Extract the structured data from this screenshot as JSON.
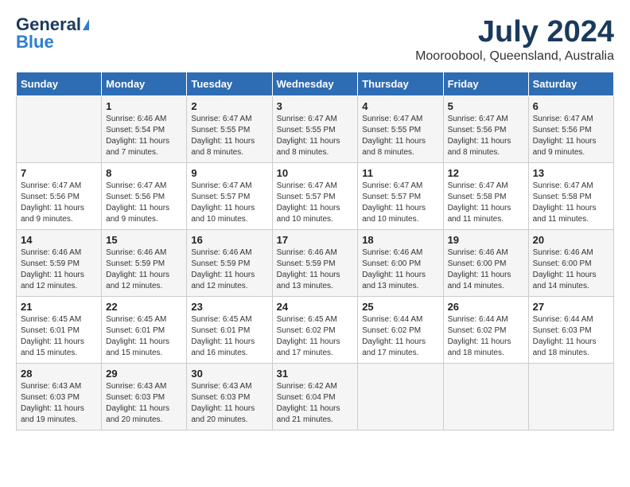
{
  "header": {
    "logo_general": "General",
    "logo_blue": "Blue",
    "month_title": "July 2024",
    "location": "Mooroobool, Queensland, Australia"
  },
  "weekdays": [
    "Sunday",
    "Monday",
    "Tuesday",
    "Wednesday",
    "Thursday",
    "Friday",
    "Saturday"
  ],
  "weeks": [
    [
      {
        "day": "",
        "sunrise": "",
        "sunset": "",
        "daylight": ""
      },
      {
        "day": "1",
        "sunrise": "6:46 AM",
        "sunset": "5:54 PM",
        "daylight": "11 hours and 7 minutes."
      },
      {
        "day": "2",
        "sunrise": "6:47 AM",
        "sunset": "5:55 PM",
        "daylight": "11 hours and 8 minutes."
      },
      {
        "day": "3",
        "sunrise": "6:47 AM",
        "sunset": "5:55 PM",
        "daylight": "11 hours and 8 minutes."
      },
      {
        "day": "4",
        "sunrise": "6:47 AM",
        "sunset": "5:55 PM",
        "daylight": "11 hours and 8 minutes."
      },
      {
        "day": "5",
        "sunrise": "6:47 AM",
        "sunset": "5:56 PM",
        "daylight": "11 hours and 8 minutes."
      },
      {
        "day": "6",
        "sunrise": "6:47 AM",
        "sunset": "5:56 PM",
        "daylight": "11 hours and 9 minutes."
      }
    ],
    [
      {
        "day": "7",
        "sunrise": "6:47 AM",
        "sunset": "5:56 PM",
        "daylight": "11 hours and 9 minutes."
      },
      {
        "day": "8",
        "sunrise": "6:47 AM",
        "sunset": "5:56 PM",
        "daylight": "11 hours and 9 minutes."
      },
      {
        "day": "9",
        "sunrise": "6:47 AM",
        "sunset": "5:57 PM",
        "daylight": "11 hours and 10 minutes."
      },
      {
        "day": "10",
        "sunrise": "6:47 AM",
        "sunset": "5:57 PM",
        "daylight": "11 hours and 10 minutes."
      },
      {
        "day": "11",
        "sunrise": "6:47 AM",
        "sunset": "5:57 PM",
        "daylight": "11 hours and 10 minutes."
      },
      {
        "day": "12",
        "sunrise": "6:47 AM",
        "sunset": "5:58 PM",
        "daylight": "11 hours and 11 minutes."
      },
      {
        "day": "13",
        "sunrise": "6:47 AM",
        "sunset": "5:58 PM",
        "daylight": "11 hours and 11 minutes."
      }
    ],
    [
      {
        "day": "14",
        "sunrise": "6:46 AM",
        "sunset": "5:59 PM",
        "daylight": "11 hours and 12 minutes."
      },
      {
        "day": "15",
        "sunrise": "6:46 AM",
        "sunset": "5:59 PM",
        "daylight": "11 hours and 12 minutes."
      },
      {
        "day": "16",
        "sunrise": "6:46 AM",
        "sunset": "5:59 PM",
        "daylight": "11 hours and 12 minutes."
      },
      {
        "day": "17",
        "sunrise": "6:46 AM",
        "sunset": "5:59 PM",
        "daylight": "11 hours and 13 minutes."
      },
      {
        "day": "18",
        "sunrise": "6:46 AM",
        "sunset": "6:00 PM",
        "daylight": "11 hours and 13 minutes."
      },
      {
        "day": "19",
        "sunrise": "6:46 AM",
        "sunset": "6:00 PM",
        "daylight": "11 hours and 14 minutes."
      },
      {
        "day": "20",
        "sunrise": "6:46 AM",
        "sunset": "6:00 PM",
        "daylight": "11 hours and 14 minutes."
      }
    ],
    [
      {
        "day": "21",
        "sunrise": "6:45 AM",
        "sunset": "6:01 PM",
        "daylight": "11 hours and 15 minutes."
      },
      {
        "day": "22",
        "sunrise": "6:45 AM",
        "sunset": "6:01 PM",
        "daylight": "11 hours and 15 minutes."
      },
      {
        "day": "23",
        "sunrise": "6:45 AM",
        "sunset": "6:01 PM",
        "daylight": "11 hours and 16 minutes."
      },
      {
        "day": "24",
        "sunrise": "6:45 AM",
        "sunset": "6:02 PM",
        "daylight": "11 hours and 17 minutes."
      },
      {
        "day": "25",
        "sunrise": "6:44 AM",
        "sunset": "6:02 PM",
        "daylight": "11 hours and 17 minutes."
      },
      {
        "day": "26",
        "sunrise": "6:44 AM",
        "sunset": "6:02 PM",
        "daylight": "11 hours and 18 minutes."
      },
      {
        "day": "27",
        "sunrise": "6:44 AM",
        "sunset": "6:03 PM",
        "daylight": "11 hours and 18 minutes."
      }
    ],
    [
      {
        "day": "28",
        "sunrise": "6:43 AM",
        "sunset": "6:03 PM",
        "daylight": "11 hours and 19 minutes."
      },
      {
        "day": "29",
        "sunrise": "6:43 AM",
        "sunset": "6:03 PM",
        "daylight": "11 hours and 20 minutes."
      },
      {
        "day": "30",
        "sunrise": "6:43 AM",
        "sunset": "6:03 PM",
        "daylight": "11 hours and 20 minutes."
      },
      {
        "day": "31",
        "sunrise": "6:42 AM",
        "sunset": "6:04 PM",
        "daylight": "11 hours and 21 minutes."
      },
      {
        "day": "",
        "sunrise": "",
        "sunset": "",
        "daylight": ""
      },
      {
        "day": "",
        "sunrise": "",
        "sunset": "",
        "daylight": ""
      },
      {
        "day": "",
        "sunrise": "",
        "sunset": "",
        "daylight": ""
      }
    ]
  ],
  "labels": {
    "sunrise_prefix": "Sunrise: ",
    "sunset_prefix": "Sunset: ",
    "daylight_prefix": "Daylight: "
  }
}
